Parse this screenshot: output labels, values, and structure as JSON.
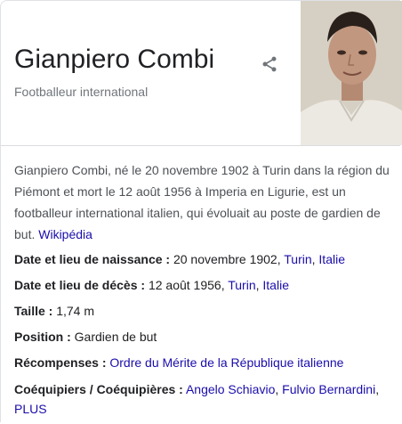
{
  "entity": {
    "name": "Gianpiero Combi",
    "subtitle": "Footballeur international"
  },
  "description": {
    "text": "Gianpiero Combi, né le 20 novembre 1902 à Turin dans la région du Piémont et mort le 12 août 1956 à Imperia en Ligurie, est un footballeur international italien, qui évoluait au poste de gardien de but.",
    "source_link": "Wikipédia"
  },
  "facts": {
    "birth": {
      "label": "Date et lieu de naissance :",
      "value": "20 novembre 1902,",
      "link1": "Turin",
      "sep": ",",
      "link2": "Italie"
    },
    "death": {
      "label": "Date et lieu de décès :",
      "value": "12 août 1956,",
      "link1": "Turin",
      "sep": ",",
      "link2": "Italie"
    },
    "height": {
      "label": "Taille :",
      "value": "1,74 m"
    },
    "position": {
      "label": "Position :",
      "value": "Gardien de but"
    },
    "awards": {
      "label": "Récompenses :",
      "link": "Ordre du Mérite de la République italienne"
    },
    "teammates": {
      "label": "Coéquipiers / Coéquipières :",
      "link1": "Angelo Schiavio",
      "sep": ",",
      "link2": "Fulvio Bernardini",
      "sep2": ",",
      "more": "PLUS"
    }
  },
  "colors": {
    "link": "#1a0dab",
    "text": "#202124",
    "muted": "#70757a"
  },
  "icons": {
    "share": "share-icon"
  }
}
